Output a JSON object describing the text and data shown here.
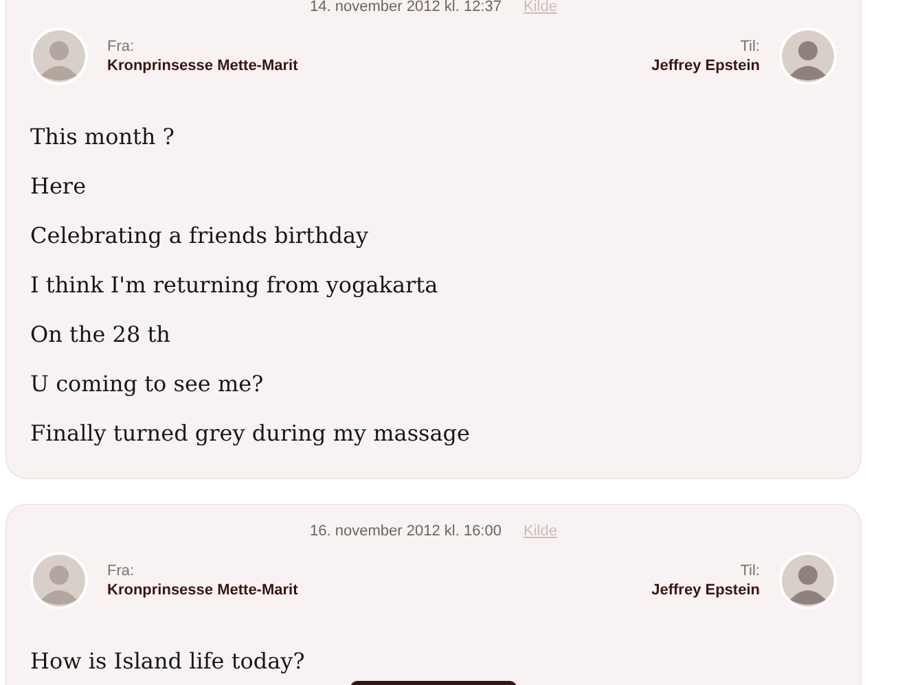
{
  "emails": [
    {
      "date": "14. november 2012 kl. 12:37",
      "source_link": "Kilde",
      "from": {
        "label": "Fra:",
        "name": "Kronprinsesse Mette-Marit"
      },
      "to": {
        "label": "Til:",
        "name": "Jeffrey Epstein"
      },
      "lines": [
        "This month ?",
        "Here",
        "Celebrating a friends birthday",
        "I think I'm returning from yogakarta",
        "On the 28 th",
        "U coming to see me?",
        "Finally turned grey during my massage"
      ]
    },
    {
      "date": "16. november 2012 kl. 16:00",
      "source_link": "Kilde",
      "from": {
        "label": "Fra:",
        "name": "Kronprinsesse Mette-Marit"
      },
      "to": {
        "label": "Til:",
        "name": "Jeffrey Epstein"
      },
      "lines": [
        "How is Island life today?"
      ]
    }
  ]
}
